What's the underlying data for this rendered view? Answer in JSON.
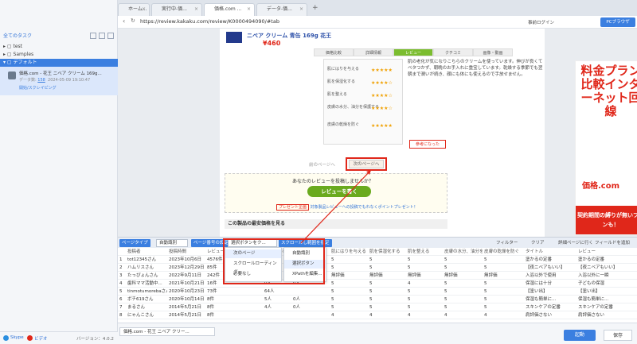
{
  "sidebar": {
    "tasks_header": "全てのタスク",
    "tree": [
      {
        "label": "test"
      },
      {
        "label": "Samples"
      },
      {
        "label": "デフォルト"
      }
    ],
    "task": {
      "title": "価格.com - 花王 ニベア クリーム 169g...",
      "meta_label": "データ数:",
      "meta_count": "158",
      "meta_date": "2024-05-09 19:10:47",
      "status": "開始/スクレイピング"
    },
    "footer": {
      "skype": "Skype",
      "video": "ビデオ",
      "version": "バージョン：4.0.2"
    }
  },
  "tabs": [
    {
      "label": "ホーム..."
    },
    {
      "label": "実行中-価..."
    },
    {
      "label": "価格.com ..."
    },
    {
      "label": "データ-価..."
    }
  ],
  "address": {
    "url": "https://review.kakaku.com/review/K0000494090/#tab",
    "login": "事前ログイン",
    "browser": "PCブラウザ"
  },
  "webpage": {
    "product_title": "ニベア クリーム 青缶 169g 花王",
    "price": "¥460",
    "tabs": [
      "価格比較",
      "詳細情報",
      "レビュー",
      "クチコミ",
      "画像・動画"
    ],
    "ratings": [
      {
        "label": "肌にはりを与える",
        "stars": "★★★★★"
      },
      {
        "label": "肌を保湿化する",
        "stars": "★★★★☆"
      },
      {
        "label": "肌を整える",
        "stars": "★★★★☆"
      },
      {
        "label": "皮膚の水分、油分を保護する",
        "stars": "★★★★☆"
      },
      {
        "label": "皮膚の乾燥を防ぐ",
        "stars": "★★★★★"
      }
    ],
    "review_text": "肌の老化が気になりこちらのクリームを使っています。伸びが良くてベタつかず、朝晩のお手入れに重宝しています。乾燥する季節でも翌朝まで潤いが続き、顔にも体にも使えるので手放せません。",
    "helpful_label": "参考になった",
    "prev_label": "前のページへ",
    "next_label": "次のページへ",
    "review_prompt": "あなたのレビューを投稿しませんか？",
    "review_button": "レビューを書く",
    "present_label": "プレゼント企画",
    "present_text": "対象製品レビューへの投稿でもれなくポイントプレゼント！",
    "related_title": "この製品の最安価格を見る",
    "ad_text": "料金プラン比較インターネット回線",
    "ad_logo": "価格.com",
    "ad_bottom": "契約期間の縛りが無いプランも！"
  },
  "toolbar": {
    "page_type_label": "ページタイプ",
    "page_type_value": "自動識別",
    "page_num_label": "ページ番号の設定",
    "page_num_value": "選択ボタンをク...",
    "scroll_label": "スクロールし範囲を指定",
    "filter": "フィルター",
    "clear": "クリア",
    "detail": "詳細ページに行く",
    "add_field": "フィールドを追加"
  },
  "menu1": [
    "次のページ",
    "スクロールローディング",
    "必要なし"
  ],
  "menu2": [
    "自動識別",
    "選択ボタン",
    "XPathを編集..."
  ],
  "grid": {
    "headers": [
      "投稿者",
      "投稿時間",
      "レビュー",
      "",
      "参考になる",
      "バッジ",
      "肌にはりを与える",
      "肌を保湿化する",
      "肌を整える",
      "皮膚の水分、油分を",
      "皮膚の乾燥を防ぐ",
      "タイトル",
      "レビュー"
    ],
    "rows": [
      [
        "tot12345さん",
        "2023年10月6日",
        "4576件",
        "",
        "",
        "",
        "5",
        "5",
        "5",
        "5",
        "5",
        "塗かるの定番",
        "塗かるの定番"
      ],
      [
        "ハムリスさん",
        "2023年12月29日",
        "85件",
        "",
        "1人",
        "0人",
        "5",
        "5",
        "5",
        "5",
        "5",
        "【夜ニベアもいい】",
        "【夜ニベアもいい】"
      ],
      [
        "たっぴょんさん",
        "2022年9月11日",
        "242件",
        "",
        "2326人",
        "4人",
        "無評価",
        "無評価",
        "無評価",
        "無評価",
        "無評価",
        "入浴以外で使用",
        "入浴以外に一瞬"
      ],
      [
        "歯科ママ活動中...",
        "2021年10月21日",
        "16件",
        "",
        "0人",
        "0人",
        "5",
        "5",
        "4",
        "5",
        "5",
        "保湿には十分",
        "子どもの保湿"
      ],
      [
        "tinmotumorebaさん",
        "2020年10月23日",
        "73件",
        "",
        "64人",
        "",
        "5",
        "5",
        "5",
        "5",
        "5",
        "【塗い出】",
        "【塗い出】"
      ],
      [
        "ボチ619さん",
        "2020年10月14日",
        "8件",
        "",
        "5人",
        "0人",
        "5",
        "5",
        "5",
        "5",
        "5",
        "保湿も簡単に…",
        "保湿も簡単に…"
      ],
      [
        "まるさん",
        "2014年5月21日",
        "8件",
        "",
        "4人",
        "0人",
        "5",
        "5",
        "5",
        "5",
        "5",
        "スキンケアの定番",
        "スキンケアの定番"
      ],
      [
        "にゃんこさん",
        "2014年5月21日",
        "8件",
        "",
        "",
        "",
        "4",
        "4",
        "4",
        "4",
        "4",
        "肩評価さない",
        "肩評価さない"
      ]
    ]
  },
  "bottom": {
    "task_tab": "価格.com - 花王 ニベア クリー...",
    "start": "起動",
    "save": "保存"
  },
  "colors": {
    "accent": "#3b7fe0",
    "highlight": "#e0271a",
    "green": "#6aaa1e"
  }
}
